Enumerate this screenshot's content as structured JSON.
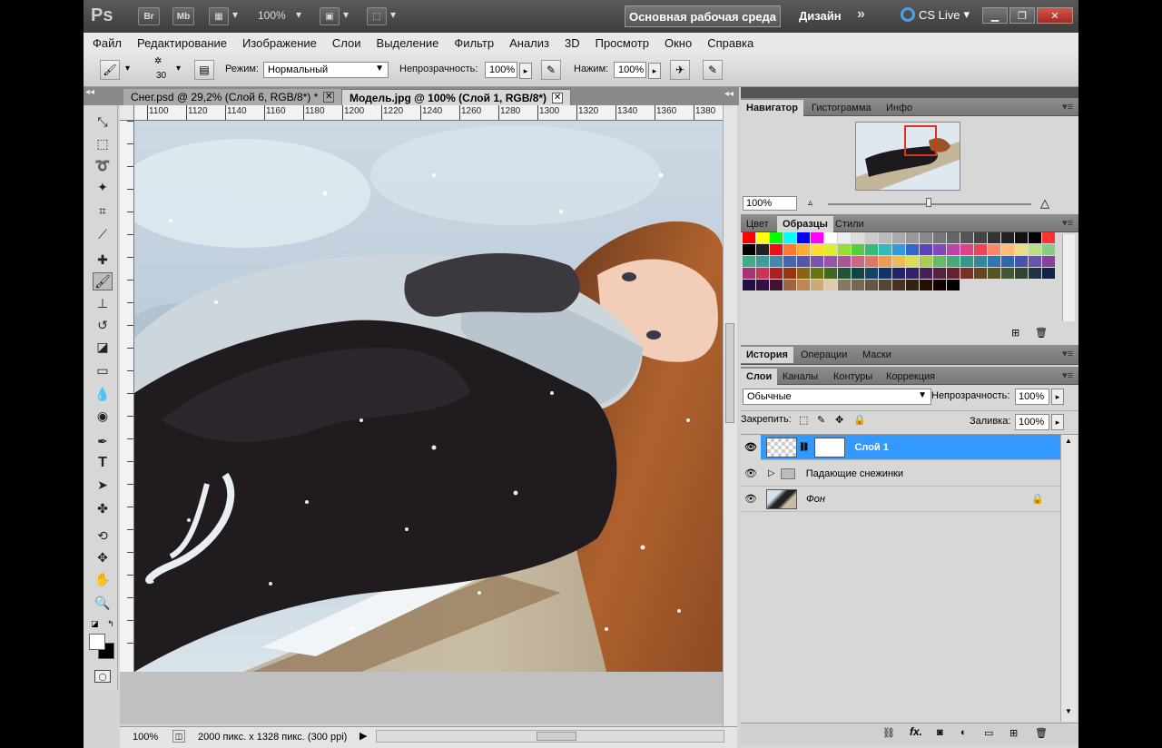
{
  "titlebar": {
    "app_logo": "Ps",
    "buttons": [
      "Br",
      "Mb"
    ],
    "zoom": "100%",
    "workspace": "Основная рабочая среда",
    "design": "Дизайн",
    "more": "»",
    "cs_live": "CS Live"
  },
  "menu": [
    "Файл",
    "Редактирование",
    "Изображение",
    "Слои",
    "Выделение",
    "Фильтр",
    "Анализ",
    "3D",
    "Просмотр",
    "Окно",
    "Справка"
  ],
  "options": {
    "brush_size": "30",
    "mode_label": "Режим:",
    "mode_value": "Нормальный",
    "opacity_label": "Непрозрачность:",
    "opacity_value": "100%",
    "pressure_label": "Нажим:",
    "pressure_value": "100%"
  },
  "tabs": [
    {
      "label": "Снег.psd @ 29,2% (Слой 6, RGB/8*) *",
      "close": "✕"
    },
    {
      "label": "Модель.jpg @ 100% (Слой 1, RGB/8*)",
      "close": "✕"
    }
  ],
  "ruler": [
    "1100",
    "1120",
    "1140",
    "1160",
    "1180",
    "1200",
    "1220",
    "1240",
    "1260",
    "1280",
    "1300",
    "1320",
    "1340",
    "1360",
    "1380"
  ],
  "status": {
    "zoom": "100%",
    "doc_info": "2000 пикс. x 1328 пикс. (300 ppi)"
  },
  "nav_panel": {
    "tabs": [
      "Навигатор",
      "Гистограмма",
      "Инфо"
    ],
    "zoom": "100%"
  },
  "swatch_panel": {
    "tabs": [
      "Цвет",
      "Образцы",
      "Стили"
    ]
  },
  "history_panel": {
    "tabs": [
      "История",
      "Операции",
      "Маски"
    ]
  },
  "layers_panel": {
    "tabs": [
      "Слои",
      "Каналы",
      "Контуры",
      "Коррекция"
    ],
    "blend_mode": "Обычные",
    "opacity_label": "Непрозрачность:",
    "opacity_value": "100%",
    "lock_label": "Закрепить:",
    "fill_label": "Заливка:",
    "fill_value": "100%",
    "layers": [
      {
        "name": "Слой 1"
      },
      {
        "name": "Падающие снежинки"
      },
      {
        "name": "Фон"
      }
    ]
  },
  "colors": {
    "accent": "#3399ff"
  }
}
